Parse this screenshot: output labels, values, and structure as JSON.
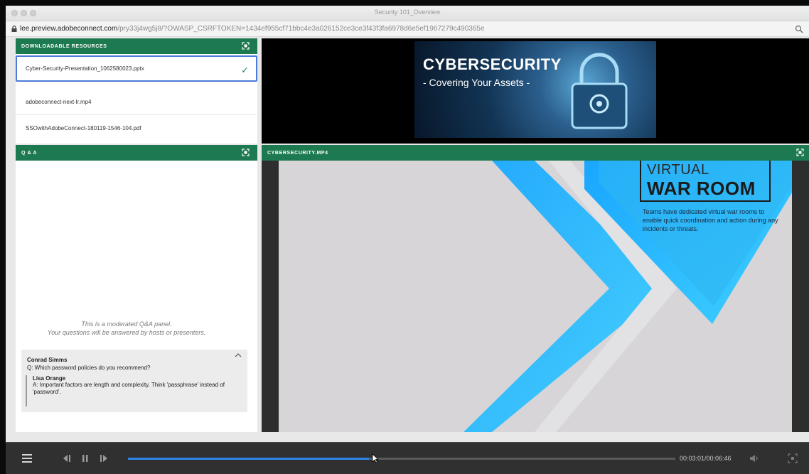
{
  "window": {
    "title": "Security 101_Overview",
    "url_host": "lee.preview.adobeconnect.com",
    "url_rest": "/pry33j4wg5j8/?OWASP_CSRFTOKEN=1434ef955cf71bbc4e3a026152ce3ce3f43f3fa6978d6e5ef1967279c490365e"
  },
  "downloads": {
    "title": "DOWNLOADABLE RESOURCES",
    "files": [
      {
        "name": "Cyber-Security-Presentation_1062580023.pptx",
        "selected": true
      },
      {
        "name": "adobeconnect-next-lr.mp4",
        "selected": false
      },
      {
        "name": "SSOwithAdobeConnect-180119-1546-104.pdf",
        "selected": false
      }
    ],
    "check_icon": "checkmark-icon"
  },
  "qa": {
    "title": "Q & A",
    "empty_line1": "This is a moderated Q&A panel.",
    "empty_line2": "Your questions will be answered by hosts or presenters.",
    "thread": {
      "asker": "Conrad Simms",
      "question": "Q: Which password policies do you recommend?",
      "answerer": "Lisa Orange",
      "answer_line1": "A: Important factors are length and complexity. Think 'passphrase' instead of",
      "answer_line2": "'password'."
    }
  },
  "banner": {
    "title": "CYBERSECURITY",
    "subtitle": "- Covering Your Assets -"
  },
  "video": {
    "title": "CYBERSECURITY.MP4",
    "slide_heading1": "VIRTUAL",
    "slide_heading2": "WAR ROOM",
    "slide_body": "Teams have dedicated virtual war rooms to enable quick coordination and action during any incidents or threats."
  },
  "player": {
    "timecode": "00:03:01/00:06:46",
    "progress_fraction": 0.44,
    "icons": [
      "menu-icon",
      "step-back-icon",
      "pause-icon",
      "step-forward-icon",
      "volume-icon",
      "fullscreen-icon"
    ]
  },
  "colors": {
    "pod_header": "#1d7a50",
    "accent_blue": "#2f85e8",
    "selection_border": "#4c7bd6"
  }
}
